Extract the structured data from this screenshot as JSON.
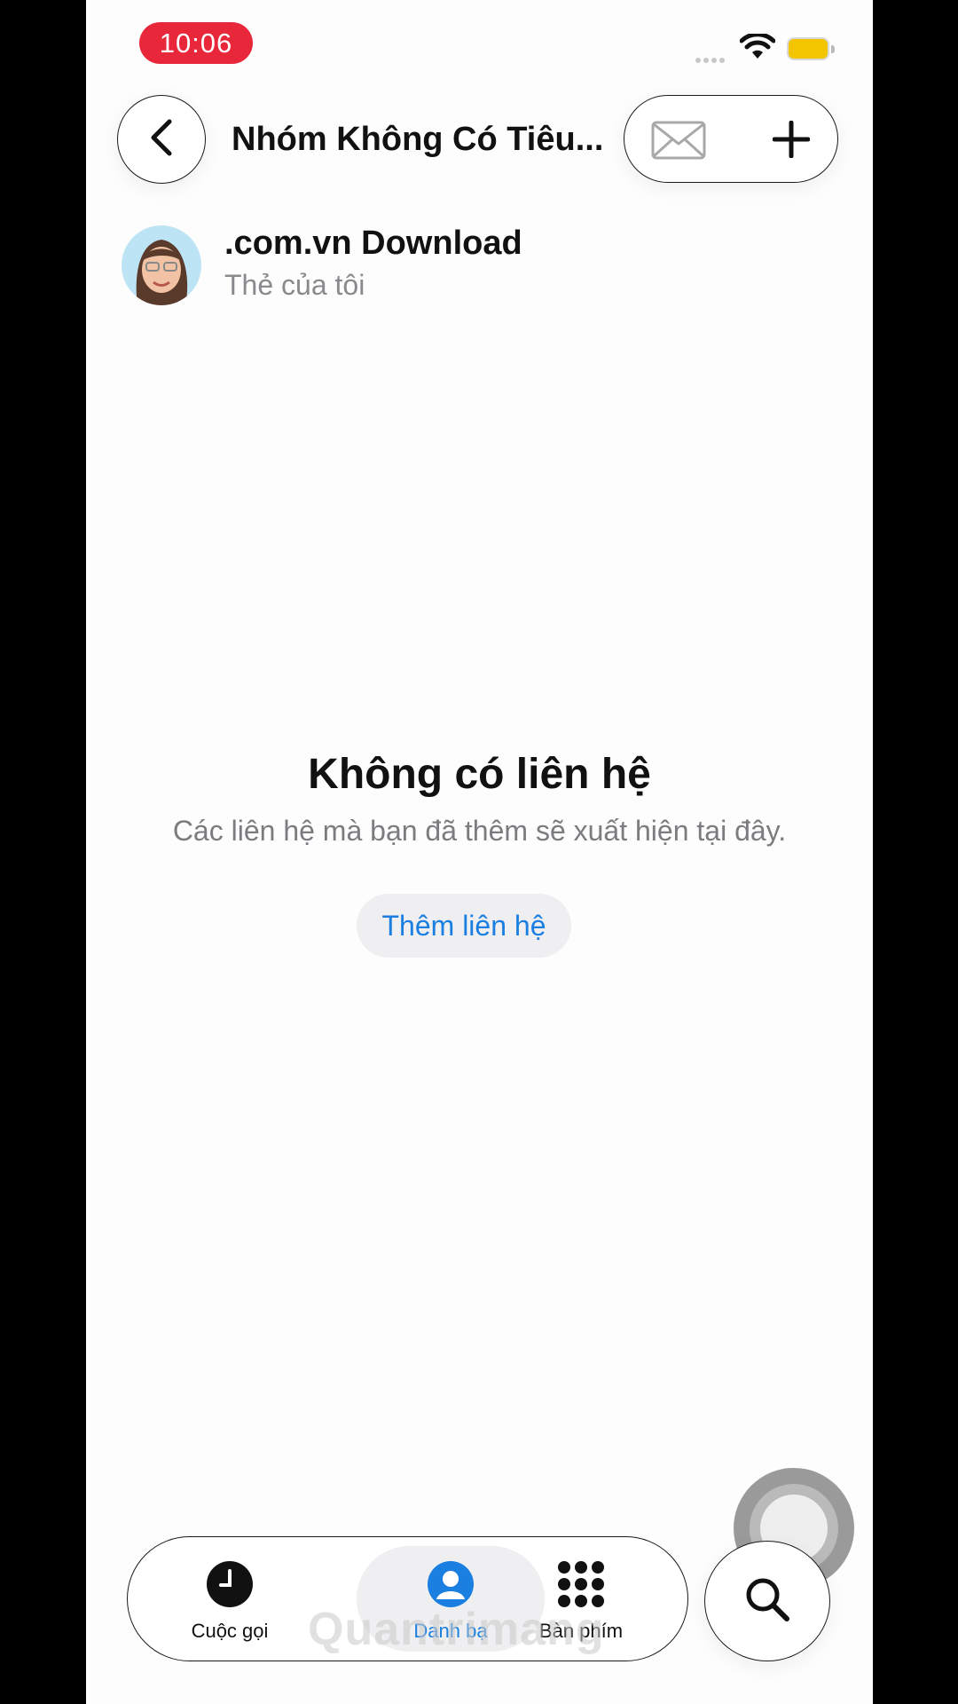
{
  "status_bar": {
    "time": "10:06"
  },
  "nav": {
    "title": "Nhóm Không Có Tiêu..."
  },
  "my_card": {
    "name": ".com.vn Download",
    "subtitle": "Thẻ của tôi"
  },
  "empty_state": {
    "title": "Không có liên hệ",
    "description": "Các liên hệ mà bạn đã thêm sẽ xuất hiện tại đây.",
    "add_button": "Thêm liên hệ"
  },
  "tabs": [
    {
      "label": "Cuộc gọi",
      "icon": "clock-icon",
      "active": false
    },
    {
      "label": "Danh bạ",
      "icon": "person-circle-icon",
      "active": true
    },
    {
      "label": "Bàn phím",
      "icon": "keypad-icon",
      "active": false
    }
  ],
  "watermark": "Quantrimang",
  "colors": {
    "accent": "#1a7fe0",
    "time_pill": "#e8283a",
    "battery": "#f2c500"
  }
}
